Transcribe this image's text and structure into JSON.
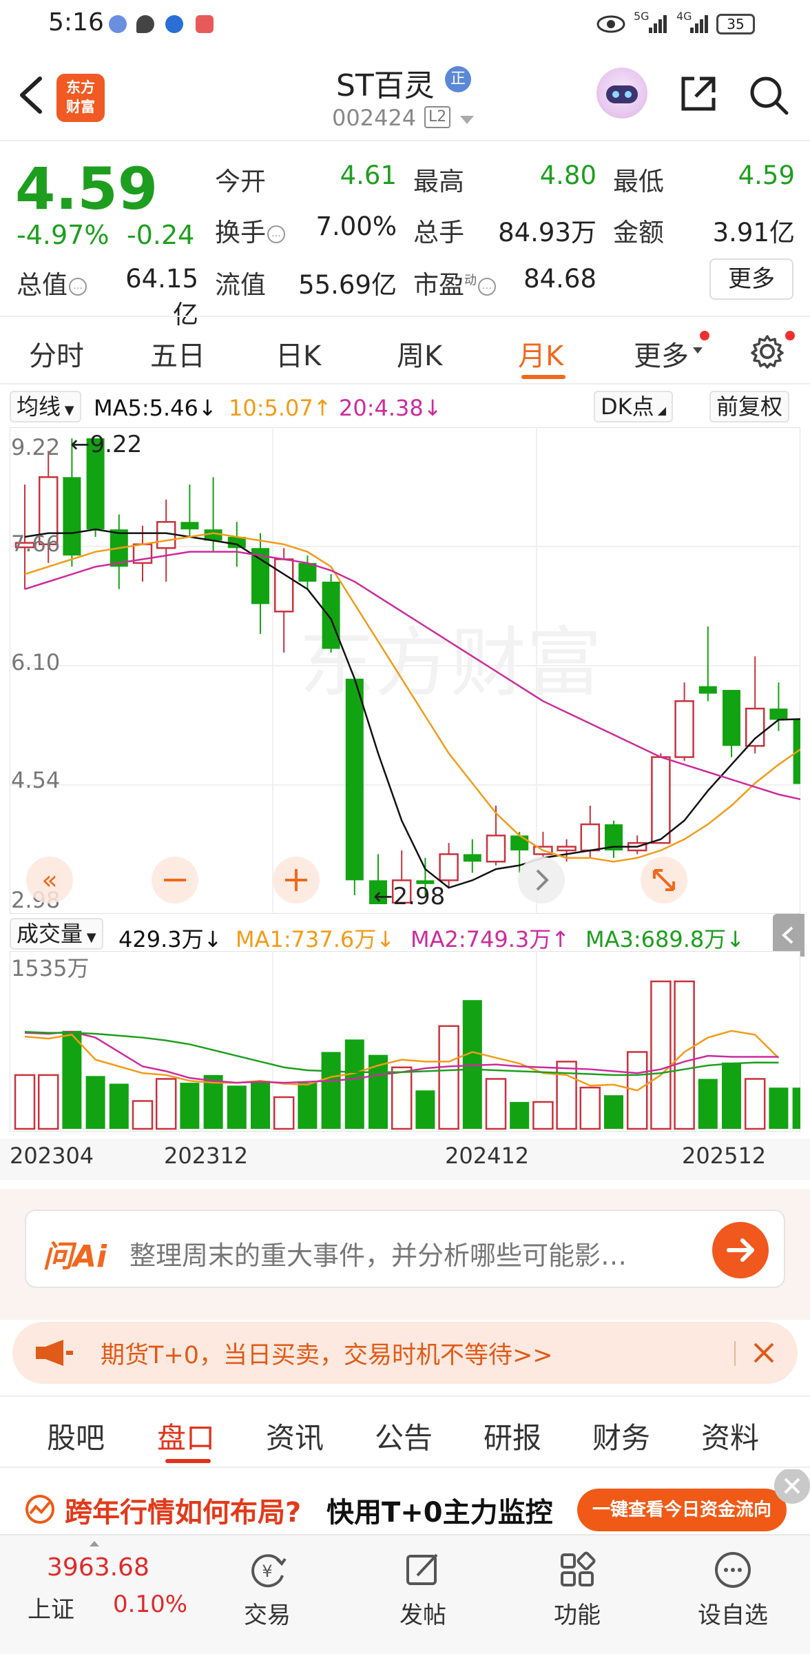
{
  "status_bar": {
    "time": "5:16",
    "battery": "35",
    "signal1": "5G",
    "signal2": "4G"
  },
  "header": {
    "logo_line1": "东方",
    "logo_line2": "财富",
    "stock_name": "ST百灵",
    "badge": "正",
    "stock_code": "002424",
    "level": "L2"
  },
  "quote": {
    "price": "4.59",
    "change_pct": "-4.97%",
    "change_val": "-0.24",
    "fields": [
      {
        "label": "今开",
        "value": "4.61",
        "color": "green"
      },
      {
        "label": "最高",
        "value": "4.80",
        "color": "green"
      },
      {
        "label": "最低",
        "value": "4.59",
        "color": "green"
      },
      {
        "label": "换手",
        "value": "7.00%",
        "color": "black"
      },
      {
        "label": "总手",
        "value": "84.93万",
        "color": "black"
      },
      {
        "label": "金额",
        "value": "3.91亿",
        "color": "black"
      },
      {
        "label": "总值",
        "value": "64.15亿",
        "color": "black"
      },
      {
        "label": "流值",
        "value": "55.69亿",
        "color": "black"
      },
      {
        "label": "市盈",
        "value": "84.68",
        "color": "black"
      }
    ],
    "pe_sup": "动",
    "more_label": "更多"
  },
  "tabs": [
    "分时",
    "五日",
    "日K",
    "周K",
    "月K",
    "更多"
  ],
  "active_tab": "月K",
  "ma_row": {
    "type_label": "均线",
    "ma5": "MA5:5.46",
    "ma10": "10:5.07",
    "ma20": "20:4.38",
    "dk_label": "DK点",
    "adjust_label": "前复权"
  },
  "vol_row": {
    "type_label": "成交量",
    "current": "429.3万",
    "ma1": "MA1:737.6万",
    "ma2": "MA2:749.3万",
    "ma3": "MA3:689.8万"
  },
  "colors": {
    "up": "#c8323c",
    "down": "#12a312",
    "ma5": "#111111",
    "ma10": "#f29b18",
    "ma20": "#cc2b9c",
    "accent": "#f1681d"
  },
  "chart_data": [
    {
      "type": "candlestick",
      "title": "ST百灵 月K",
      "y_ticks": [
        "9.22",
        "7.66",
        "6.10",
        "4.54",
        "2.98"
      ],
      "ylim": [
        2.98,
        9.22
      ],
      "high_label": "9.22",
      "low_label": "2.98",
      "x_ticks": [
        "202304",
        "202312",
        "202412",
        "202512"
      ],
      "watermark": "东方财富",
      "candles": [
        {
          "o": 7.76,
          "c": 7.82,
          "h": 8.6,
          "l": 7.2
        },
        {
          "o": 7.8,
          "c": 8.7,
          "h": 9.05,
          "l": 7.55
        },
        {
          "o": 8.7,
          "c": 7.65,
          "h": 9.22,
          "l": 7.5
        },
        {
          "o": 9.22,
          "c": 8.0,
          "h": 9.22,
          "l": 7.9
        },
        {
          "o": 8.0,
          "c": 7.5,
          "h": 8.2,
          "l": 7.2
        },
        {
          "o": 7.55,
          "c": 7.8,
          "h": 8.05,
          "l": 7.3
        },
        {
          "o": 7.75,
          "c": 8.1,
          "h": 8.4,
          "l": 7.3
        },
        {
          "o": 8.1,
          "c": 8.0,
          "h": 8.6,
          "l": 7.9
        },
        {
          "o": 8.0,
          "c": 7.85,
          "h": 8.7,
          "l": 7.7
        },
        {
          "o": 7.9,
          "c": 7.75,
          "h": 8.1,
          "l": 7.5
        },
        {
          "o": 7.75,
          "c": 7.0,
          "h": 7.95,
          "l": 6.6
        },
        {
          "o": 6.9,
          "c": 7.6,
          "h": 7.75,
          "l": 6.35
        },
        {
          "o": 7.55,
          "c": 7.3,
          "h": 7.65,
          "l": 7.2
        },
        {
          "o": 7.3,
          "c": 6.4,
          "h": 7.4,
          "l": 6.35
        },
        {
          "o": 6.0,
          "c": 3.3,
          "h": 6.0,
          "l": 3.1
        },
        {
          "o": 3.3,
          "c": 2.98,
          "h": 3.65,
          "l": 2.98
        },
        {
          "o": 3.0,
          "c": 3.3,
          "h": 3.7,
          "l": 2.98
        },
        {
          "o": 3.3,
          "c": 3.25,
          "h": 3.6,
          "l": 3.1
        },
        {
          "o": 3.3,
          "c": 3.65,
          "h": 3.8,
          "l": 3.2
        },
        {
          "o": 3.65,
          "c": 3.55,
          "h": 3.85,
          "l": 3.4
        },
        {
          "o": 3.55,
          "c": 3.9,
          "h": 4.3,
          "l": 3.5
        },
        {
          "o": 3.9,
          "c": 3.7,
          "h": 3.95,
          "l": 3.4
        },
        {
          "o": 3.65,
          "c": 3.75,
          "h": 3.95,
          "l": 3.6
        },
        {
          "o": 3.7,
          "c": 3.75,
          "h": 3.85,
          "l": 3.55
        },
        {
          "o": 3.7,
          "c": 4.05,
          "h": 4.3,
          "l": 3.6
        },
        {
          "o": 4.05,
          "c": 3.7,
          "h": 4.1,
          "l": 3.6
        },
        {
          "o": 3.7,
          "c": 3.8,
          "h": 3.9,
          "l": 3.65
        },
        {
          "o": 3.8,
          "c": 4.95,
          "h": 5.0,
          "l": 3.8
        },
        {
          "o": 4.95,
          "c": 5.7,
          "h": 5.95,
          "l": 4.9
        },
        {
          "o": 5.9,
          "c": 5.8,
          "h": 6.7,
          "l": 5.7
        },
        {
          "o": 5.85,
          "c": 5.1,
          "h": 5.85,
          "l": 4.95
        },
        {
          "o": 5.1,
          "c": 5.6,
          "h": 6.3,
          "l": 5.0
        },
        {
          "o": 5.6,
          "c": 5.45,
          "h": 5.95,
          "l": 5.3
        },
        {
          "o": 5.45,
          "c": 4.59,
          "h": 5.55,
          "l": 4.5
        }
      ],
      "ma5": [
        7.9,
        7.95,
        7.95,
        8.0,
        7.95,
        7.95,
        7.95,
        7.9,
        7.85,
        7.8,
        7.6,
        7.4,
        7.2,
        6.8,
        6.0,
        5.0,
        4.1,
        3.45,
        3.2,
        3.3,
        3.45,
        3.5,
        3.6,
        3.65,
        3.7,
        3.75,
        3.75,
        3.85,
        4.1,
        4.5,
        4.85,
        5.2,
        5.45,
        5.46
      ],
      "ma10": [
        7.4,
        7.5,
        7.6,
        7.7,
        7.75,
        7.8,
        7.85,
        7.9,
        7.95,
        7.9,
        7.85,
        7.8,
        7.7,
        7.5,
        7.0,
        6.5,
        6.0,
        5.5,
        5.0,
        4.6,
        4.2,
        3.9,
        3.7,
        3.6,
        3.6,
        3.55,
        3.6,
        3.7,
        3.85,
        4.05,
        4.3,
        4.6,
        4.85,
        5.07
      ],
      "ma20": [
        7.2,
        7.3,
        7.4,
        7.5,
        7.55,
        7.6,
        7.65,
        7.7,
        7.7,
        7.7,
        7.65,
        7.6,
        7.55,
        7.45,
        7.3,
        7.1,
        6.9,
        6.7,
        6.5,
        6.3,
        6.1,
        5.9,
        5.7,
        5.55,
        5.4,
        5.25,
        5.1,
        4.95,
        4.85,
        4.75,
        4.65,
        4.55,
        4.45,
        4.38
      ]
    },
    {
      "type": "bar",
      "title": "成交量",
      "y_ticks": [
        "1535万"
      ],
      "ymax": 1535,
      "unit": "万",
      "volumes": [
        560,
        560,
        1020,
        550,
        470,
        290,
        520,
        480,
        560,
        450,
        500,
        330,
        480,
        800,
        930,
        770,
        640,
        400,
        1070,
        1340,
        520,
        280,
        280,
        700,
        430,
        350,
        800,
        1535,
        1535,
        520,
        690,
        520,
        429,
        429
      ],
      "vma1": [
        960,
        940,
        980,
        720,
        650,
        580,
        560,
        500,
        480,
        480,
        500,
        470,
        460,
        540,
        580,
        660,
        720,
        700,
        700,
        800,
        740,
        680,
        580,
        560,
        450,
        460,
        400,
        560,
        800,
        950,
        1020,
        980,
        737.6
      ],
      "vma2": [
        1000,
        990,
        1010,
        950,
        800,
        650,
        600,
        530,
        500,
        480,
        490,
        480,
        490,
        500,
        520,
        560,
        590,
        630,
        650,
        660,
        670,
        650,
        640,
        630,
        620,
        600,
        580,
        620,
        700,
        760,
        750,
        750,
        749.3
      ],
      "vma3": [
        1010,
        1000,
        1000,
        990,
        970,
        950,
        920,
        880,
        820,
        760,
        700,
        640,
        610,
        600,
        590,
        590,
        590,
        600,
        610,
        620,
        610,
        600,
        590,
        580,
        570,
        560,
        560,
        580,
        620,
        660,
        680,
        690,
        689.8
      ]
    }
  ],
  "ai": {
    "logo": "问Ai",
    "prompt": "整理周末的重大事件，并分析哪些可能影…"
  },
  "promo": {
    "text": "期货T+0，当日买卖，交易时机不等待>>"
  },
  "section_tabs": [
    "股吧",
    "盘口",
    "资讯",
    "公告",
    "研报",
    "财务",
    "资料"
  ],
  "active_section": "盘口",
  "banner": {
    "text1": "跨年行情如何布局?",
    "text2": "快用T+0主力监控",
    "button": "一键查看今日资金流向"
  },
  "bottom": {
    "index_value": "3963.68",
    "index_name": "上证",
    "index_pct": "0.10%",
    "nav": [
      {
        "label": "交易",
        "icon": "trade-icon"
      },
      {
        "label": "发帖",
        "icon": "compose-icon"
      },
      {
        "label": "功能",
        "icon": "grid-icon"
      },
      {
        "label": "设自选",
        "icon": "add-favorite-icon"
      }
    ]
  }
}
